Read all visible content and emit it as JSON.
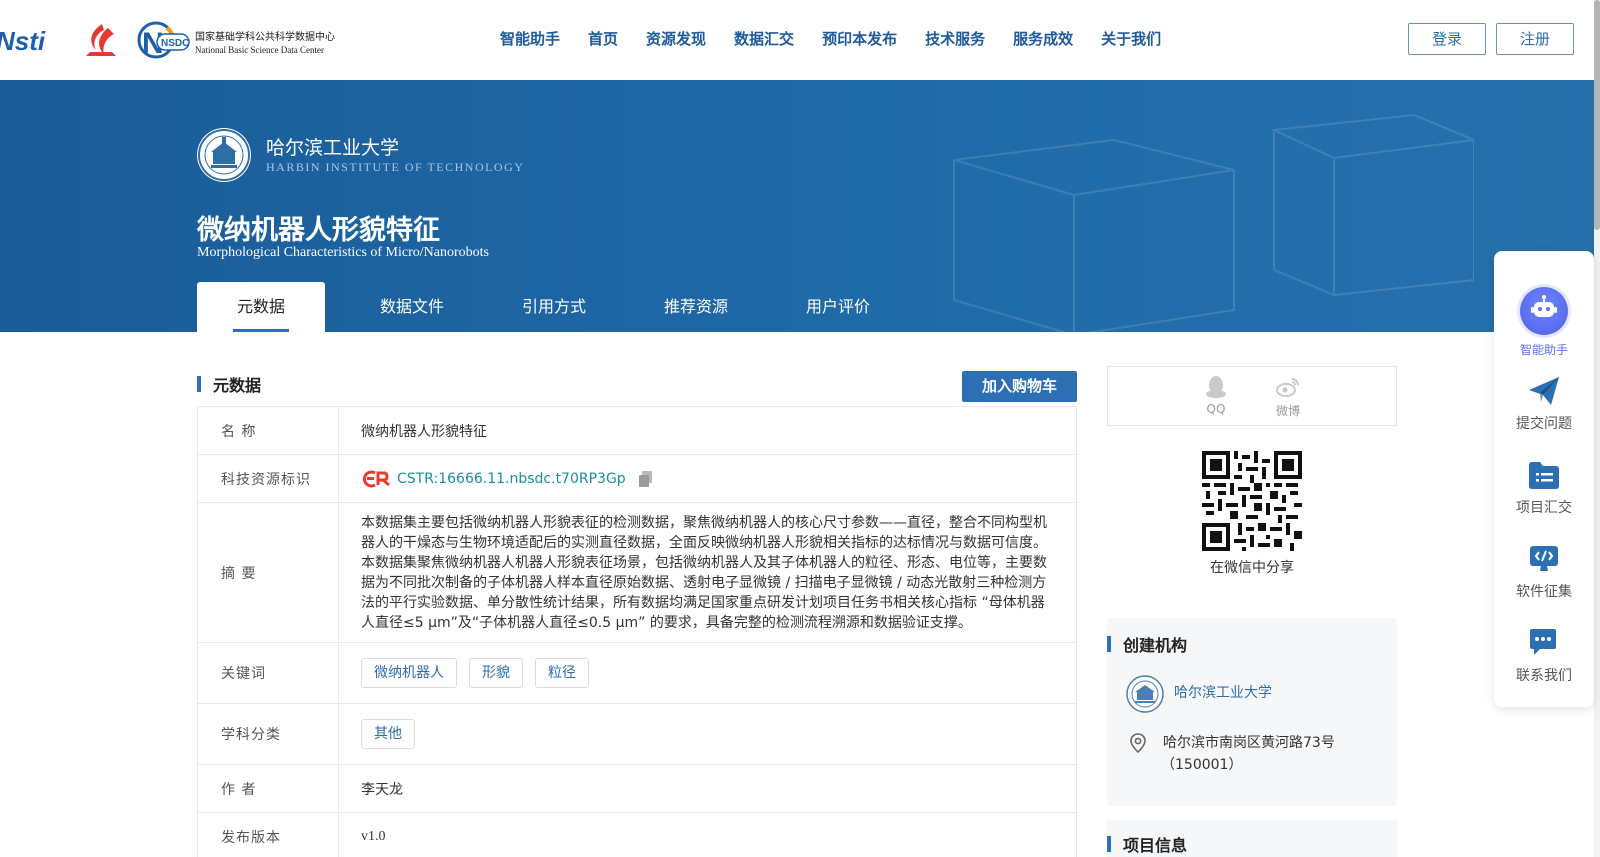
{
  "header": {
    "logo_nsti_text": "Nsti",
    "logo_nsdc_cn": "国家基础学科公共科学数据中心",
    "logo_nsdc_en": "National Basic Science Data Center",
    "logo_nsdc_mark": "NSDC",
    "nav": [
      "智能助手",
      "首页",
      "资源发现",
      "数据汇交",
      "预印本发布",
      "技术服务",
      "服务成效",
      "关于我们"
    ],
    "login_label": "登录",
    "register_label": "注册"
  },
  "banner": {
    "institution_cn": "哈尔滨工业大学",
    "institution_en": "HARBIN INSTITUTE OF TECHNOLOGY",
    "title": "微纳机器人形貌特征",
    "subtitle": "Morphological Characteristics of Micro/Nanorobots",
    "tabs": [
      "元数据",
      "数据文件",
      "引用方式",
      "推荐资源",
      "用户评价"
    ],
    "active_tab": 0
  },
  "metadata": {
    "section_title": "元数据",
    "cart_label": "加入购物车",
    "rows": {
      "name_key": "名  称",
      "name_value": "微纳机器人形貌特征",
      "id_key": "科技资源标识",
      "id_value": "CSTR:16666.11.nbsdc.t70RP3Gp",
      "abstract_key": "摘  要",
      "abstract_value": "本数据集主要包括微纳机器人形貌表征的检测数据，聚焦微纳机器人的核心尺寸参数——直径，整合不同构型机器人的干燥态与生物环境适配后的实测直径数据，全面反映微纳机器人形貌相关指标的达标情况与数据可信度。本数据集聚焦微纳机器人机器人形貌表征场景，包括微纳机器人及其子体机器人的粒径、形态、电位等，主要数据为不同批次制备的子体机器人样本直径原始数据、透射电子显微镜 / 扫描电子显微镜 / 动态光散射三种检测方法的平行实验数据、单分散性统计结果，所有数据均满足国家重点研发计划项目任务书相关核心指标 “母体机器人直径≤5 μm”及“子体机器人直径≤0.5 μm” 的要求，具备完整的检测流程溯源和数据验证支撑。",
      "keywords_key": "关键词",
      "keywords": [
        "微纳机器人",
        "形貌",
        "粒径"
      ],
      "subject_key": "学科分类",
      "subjects": [
        "其他"
      ],
      "author_key": "作  者",
      "author_value": "李天龙",
      "version_key": "发布版本",
      "version_value": "v1.0"
    }
  },
  "share": {
    "qq_label": "QQ",
    "weibo_label": "微博",
    "wechat_label": "在微信中分享"
  },
  "org": {
    "section_title": "创建机构",
    "name": "哈尔滨工业大学",
    "address_line1": "哈尔滨市南岗区黄河路73号",
    "address_line2": "（150001）"
  },
  "project": {
    "section_title": "项目信息"
  },
  "float_menu": {
    "items": [
      "智能助手",
      "提交问题",
      "项目汇交",
      "软件征集",
      "联系我们"
    ]
  },
  "colors": {
    "primary": "#2d6fb3",
    "banner": "#1a5c98",
    "nav_text": "#1e5a9e",
    "cstr": "#1a8f9c",
    "robot": "#5a6cf0"
  }
}
